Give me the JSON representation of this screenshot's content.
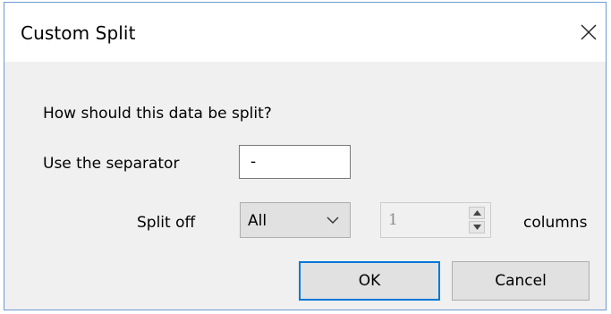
{
  "dialog": {
    "title": "Custom Split",
    "close_icon": "close-icon"
  },
  "form": {
    "question": "How should this data be split?",
    "separator_label": "Use the separator",
    "separator_value": "-",
    "split_off_label": "Split off",
    "split_off_selected": "All",
    "columns_count": "1",
    "columns_label": "columns"
  },
  "buttons": {
    "ok_label": "OK",
    "cancel_label": "Cancel"
  },
  "colors": {
    "accent": "#0078d7",
    "dialog_body": "#f0f0f0",
    "button_face": "#e1e1e1"
  }
}
